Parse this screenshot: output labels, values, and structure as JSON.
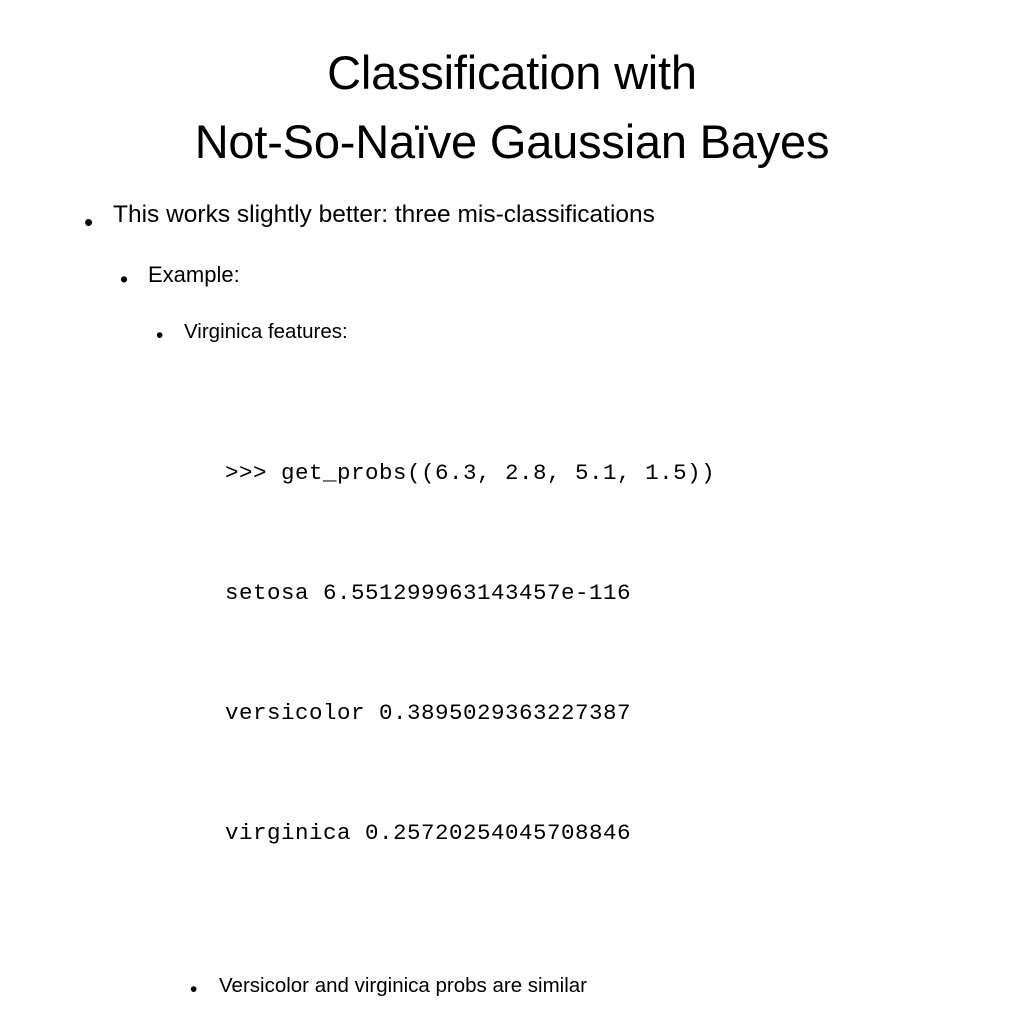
{
  "slide": {
    "title": {
      "line1": "Classification with",
      "line2": "Not-So-Naïve Gaussian Bayes"
    },
    "bullets": [
      {
        "level": 1,
        "marker": "•",
        "text": "This works slightly better: three mis-classifications"
      },
      {
        "level": 2,
        "marker": "•",
        "text": "Example:"
      },
      {
        "level": 3,
        "marker": "•",
        "text": "Virginica features:"
      },
      {
        "level": 4,
        "marker": "•",
        "text": "Versicolor and virginica probs are similar"
      }
    ],
    "code_block": {
      "prompt_line": ">>> get_probs((6.3, 2.8, 5.1, 1.5))",
      "result_setosa": "setosa 6.551299963143457e-116",
      "result_versicolor": "versicolor 0.3895029363227387",
      "result_virginica": "virginica 0.25720254045708846"
    },
    "colors": {
      "background": "#ffffff",
      "text": "#000000"
    }
  }
}
